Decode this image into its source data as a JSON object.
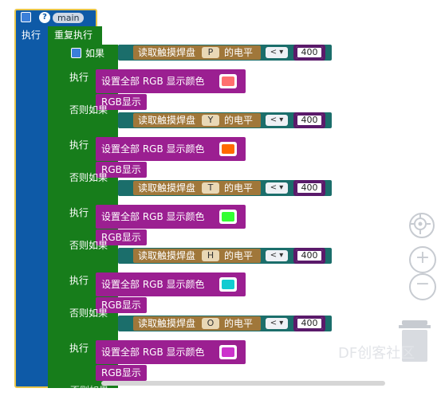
{
  "main_block": {
    "label": "main",
    "do_label": "执行",
    "loop_label": "重复执行"
  },
  "if_block": {
    "if_label": "如果",
    "do_label": "执行",
    "else_if_label": "否则如果",
    "last_partial_label": "否则如果"
  },
  "conditions": [
    {
      "read_label": "读取触摸焊盘",
      "channel": "P",
      "suffix": "的电平",
      "op": "<",
      "value": "400",
      "set_label": "设置全部 RGB 显示颜色",
      "color": "#ff6f6f",
      "show_label": "RGB显示"
    },
    {
      "read_label": "读取触摸焊盘",
      "channel": "Y",
      "suffix": "的电平",
      "op": "<",
      "value": "400",
      "set_label": "设置全部 RGB 显示颜色",
      "color": "#ff6a00",
      "show_label": "RGB显示"
    },
    {
      "read_label": "读取触摸焊盘",
      "channel": "T",
      "suffix": "的电平",
      "op": "<",
      "value": "400",
      "set_label": "设置全部 RGB 显示颜色",
      "color": "#33ff33",
      "show_label": "RGB显示"
    },
    {
      "read_label": "读取触摸焊盘",
      "channel": "H",
      "suffix": "的电平",
      "op": "<",
      "value": "400",
      "set_label": "设置全部 RGB 显示颜色",
      "color": "#11cbd1",
      "show_label": "RGB显示"
    },
    {
      "read_label": "读取触摸焊盘",
      "channel": "O",
      "suffix": "的电平",
      "op": "<",
      "value": "400",
      "set_label": "设置全部 RGB 显示颜色",
      "color": "#cc33cc",
      "show_label": "RGB显示"
    }
  ],
  "watermark": "DF创客社区",
  "icons": {
    "gear": "gear-icon",
    "help": "help-icon",
    "center": "center-target-icon",
    "zoom_in": "zoom-in-icon",
    "zoom_out": "zoom-out-icon",
    "trash": "trash-icon"
  }
}
